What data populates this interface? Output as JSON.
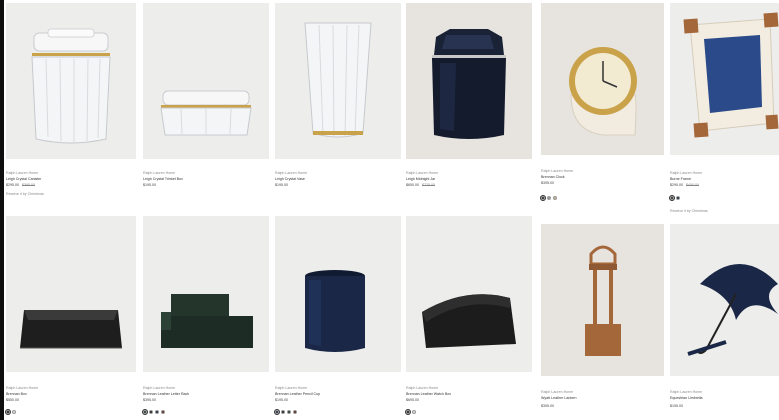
{
  "products": [
    {
      "brand": "Ralph Lauren Home",
      "name": "Leigh Crystal Canister",
      "price": "$295.00",
      "price_orig": "$395.00",
      "note": "Receive it by Christmas",
      "swatches": [],
      "colors": {
        "accent": "#c9a24a"
      }
    },
    {
      "brand": "Ralph Lauren Home",
      "name": "Leigh Crystal Trinket Box",
      "price": "$195.00",
      "price_orig": "",
      "note": "",
      "swatches": [],
      "colors": {
        "accent": "#c9a24a"
      }
    },
    {
      "brand": "Ralph Lauren Home",
      "name": "Leigh Crystal Vase",
      "price": "$195.00",
      "price_orig": "",
      "note": "",
      "swatches": [],
      "colors": {
        "accent": "#c9a24a"
      }
    },
    {
      "brand": "Ralph Lauren Home",
      "name": "Leigh Midnight Jar",
      "price": "$650.00",
      "price_orig": "$725.00",
      "note": "",
      "swatches": [],
      "colors": {
        "accent": "#1a2236"
      }
    },
    {
      "brand": "Ralph Lauren Home",
      "name": "Brennan Clock",
      "price": "$395.00",
      "price_orig": "",
      "note": "",
      "swatches": [
        "#2b2b2b",
        "#9a9a9a",
        "#c8b58c"
      ],
      "colors": {
        "accent": "#c9a24a"
      }
    },
    {
      "brand": "Ralph Lauren Home",
      "name": "Burne Frame",
      "price": "$295.00",
      "price_orig": "$450.00",
      "note": "Receive it by Christmas",
      "swatches": [
        "#333333",
        "#1a2747"
      ],
      "colors": {
        "accent": "#a3673a"
      }
    },
    {
      "brand": "Ralph Lauren Home",
      "name": "Brennan Box",
      "price": "$550.00",
      "price_orig": "",
      "note": "",
      "swatches": [
        "#1e1e1e",
        "#dcdcdc"
      ],
      "colors": {
        "accent": "#1e1e1e"
      }
    },
    {
      "brand": "Ralph Lauren Home",
      "name": "Brennan Leather Letter Rack",
      "price": "$395.00",
      "price_orig": "",
      "note": "",
      "swatches": [
        "#24362c",
        "#1c1c1c",
        "#1a2747",
        "#5a2a22"
      ],
      "colors": {
        "accent": "#24362c"
      }
    },
    {
      "brand": "Ralph Lauren Home",
      "name": "Brennan Leather Pencil Cup",
      "price": "$195.00",
      "price_orig": "",
      "note": "",
      "swatches": [
        "#1a2747",
        "#1c1c1c",
        "#24362c",
        "#5a2a22"
      ],
      "colors": {
        "accent": "#1a2747"
      }
    },
    {
      "brand": "Ralph Lauren Home",
      "name": "Brennan Leather Watch Box",
      "price": "$695.00",
      "price_orig": "",
      "note": "",
      "swatches": [
        "#1c1c1c",
        "#dcdcdc"
      ],
      "colors": {
        "accent": "#1c1c1c"
      }
    },
    {
      "brand": "Ralph Lauren Home",
      "name": "Wyatt Leather Lantern",
      "price": "$395.00",
      "price_orig": "",
      "note": "",
      "swatches": [],
      "colors": {
        "accent": "#a3673a"
      }
    },
    {
      "brand": "Ralph Lauren Home",
      "name": "Equestrian Umbrella",
      "price": "$195.00",
      "price_orig": "",
      "note": "",
      "swatches": [],
      "colors": {
        "accent": "#1a2747"
      }
    }
  ]
}
